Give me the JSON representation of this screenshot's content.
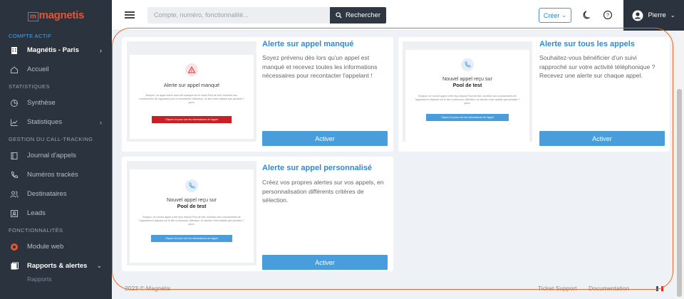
{
  "sidebar": {
    "logo": "magnetis",
    "account_section": "COMPTE ACTIF",
    "account_name": "Magnétis - Paris",
    "home": "Accueil",
    "stats_section": "STATISTIQUES",
    "synthese": "Synthèse",
    "statistiques": "Statistiques",
    "tracking_section": "GESTION DU CALL-TRACKING",
    "journal": "Journal d'appels",
    "numeros": "Numéros trackés",
    "destinataires": "Destinataires",
    "leads": "Leads",
    "features_section": "FONCTIONNALITÉS",
    "module_web": "Module web",
    "rapports": "Rapports & alertes",
    "rapports_sub": "Rapports"
  },
  "header": {
    "search_placeholder": "Compte, numéro, fonctionnalité...",
    "search_button": "Rechercher",
    "create_button": "Créer",
    "user_name": "Pierre"
  },
  "cards": {
    "missed": {
      "title": "Alerte sur appel manqué",
      "description": "Soyez prévenu dès lors qu'un appel est manqué et recevez toutes les informations nécessaires pour recontacter l'appelant !",
      "button": "Activer",
      "preview_title": "Alerte sur appel manqué",
      "preview_text": "Bonjour, un appel arrivé avec été manqué sur le canal Pool de test. Accédez aux coordonnées de l'appelant pour le recontacter l'Attention, ce lien reste valable que pendant 7 jours.",
      "preview_button": "Cliquez ici pour voir les informations de l'appel"
    },
    "all": {
      "title": "Alerte sur tous les appels",
      "description": "Souhaitez-vous bénéficier d'un suivi rapproché sur votre activité téléphonique ? Recevez une alerte sur chaque appel.",
      "button": "Activer",
      "preview_title": "Nouvel appel reçu sur",
      "preview_title_bold": "Pool de test",
      "preview_text": "Bonjour, un nouvel appel a été reçu depuis Pool de test. Accédez aux coordonnées de l'appelant en cliquant sur le lien ci-dessous. Attention, ce dernier n'est valable que pendant 7 jours.",
      "preview_button": "Cliquez ici pour voir les informations de l'appel"
    },
    "custom": {
      "title": "Alerte sur appel personnalisé",
      "description": "Créez vos propres alertes sur vos appels, en personnalisation différents critères de sélection.",
      "button": "Activer",
      "preview_title": "Nouvel appel reçu sur",
      "preview_title_bold": "Pool de test",
      "preview_text": "Bonjour, un nouvel appel a été reçu depuis Pool de test. Accédez aux coordonnées de l'appelant en cliquant sur le lien ci-dessous. Attention, ce dernier n'est valable que pendant 7 jours.",
      "preview_button": "Cliquez ici pour voir les informations de l'appel"
    }
  },
  "footer": {
    "copyright": "2023 © Magnétis",
    "support": "Ticket Support",
    "documentation": "Documentation"
  },
  "colors": {
    "accent": "#2f8ad6",
    "button": "#4a9ddb",
    "sidebar": "#2b333e",
    "highlight": "#ea6a24",
    "danger": "#d8282b"
  },
  "icons": [
    "menu-icon",
    "search-icon",
    "chevron-down-icon",
    "moon-icon",
    "help-icon",
    "user-icon",
    "building-icon",
    "home-icon",
    "pie-chart-icon",
    "line-chart-icon",
    "journal-icon",
    "phone-icon",
    "users-icon",
    "leads-icon",
    "module-web-icon",
    "report-icon",
    "warning-icon",
    "flag-fr-icon"
  ]
}
